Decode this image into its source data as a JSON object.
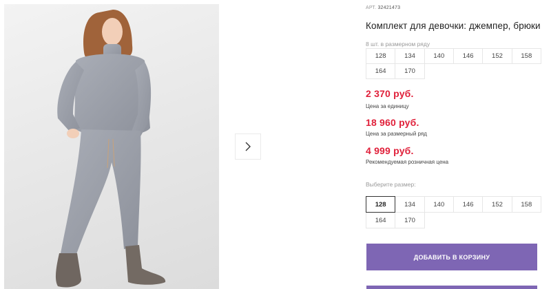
{
  "gallery": {
    "next_arrow_icon": "chevron-right-icon"
  },
  "product": {
    "sku_label": "АРТ.",
    "sku_value": "32421473",
    "title": "Комплект для девочки: джемпер, брюки",
    "row_note": "8 шт. в размерном ряду",
    "row_sizes": [
      "128",
      "134",
      "140",
      "146",
      "152",
      "158",
      "164",
      "170"
    ]
  },
  "prices": {
    "unit_price": "2 370 руб.",
    "unit_label": "Цена за единицу",
    "row_price": "18 960 руб.",
    "row_label": "Цена за размерный ряд",
    "retail_price": "4 999 руб.",
    "retail_label": "Рекомендуемая розничная цена"
  },
  "size_select": {
    "label": "Выберите размер:",
    "sizes": [
      "128",
      "134",
      "140",
      "146",
      "152",
      "158",
      "164",
      "170"
    ],
    "selected": "128"
  },
  "actions": {
    "add_to_cart": "Добавить в корзину"
  },
  "colors": {
    "accent": "#7e66b4",
    "price": "#e0203a"
  }
}
